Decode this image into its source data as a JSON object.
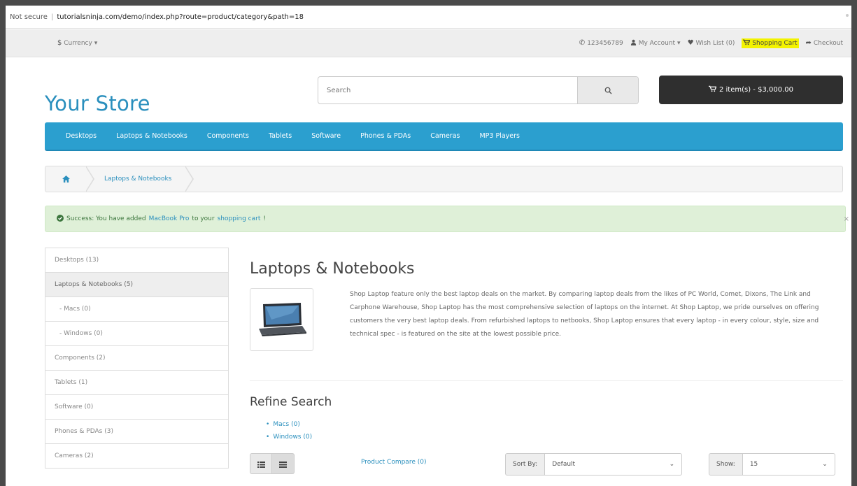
{
  "browser": {
    "security_label": "Not secure",
    "url": "tutorialsninja.com/demo/index.php?route=product/category&path=18"
  },
  "topbar": {
    "currency_symbol": "$",
    "currency_label": "Currency",
    "phone": "123456789",
    "my_account": "My Account",
    "wish_list": "Wish List (0)",
    "shopping_cart": "Shopping Cart",
    "checkout": "Checkout",
    "highlight_color": "#f3f300"
  },
  "header": {
    "logo": "Your Store",
    "search_placeholder": "Search",
    "cart_summary": "2 item(s) - $3,000.00"
  },
  "nav": {
    "items": [
      "Desktops",
      "Laptops & Notebooks",
      "Components",
      "Tablets",
      "Software",
      "Phones & PDAs",
      "Cameras",
      "MP3 Players"
    ],
    "color": "#2b9fcf"
  },
  "breadcrumb": {
    "current": "Laptops & Notebooks"
  },
  "alert": {
    "prefix": "Success: You have added",
    "product": "MacBook Pro",
    "middle": "to your",
    "cart_link": "shopping cart",
    "suffix": "!"
  },
  "sidebar": {
    "items": [
      "Desktops (13)",
      "Laptops & Notebooks (5)",
      "- Macs (0)",
      "- Windows (0)",
      "Components (2)",
      "Tablets (1)",
      "Software (0)",
      "Phones & PDAs (3)",
      "Cameras (2)"
    ]
  },
  "content": {
    "title": "Laptops & Notebooks",
    "description": "Shop Laptop feature only the best laptop deals on the market. By comparing laptop deals from the likes of PC World, Comet, Dixons, The Link and Carphone Warehouse, Shop Laptop has the most comprehensive selection of laptops on the internet. At Shop Laptop, we pride ourselves on offering customers the very best laptop deals. From refurbished laptops to netbooks, Shop Laptop ensures that every laptop - in every colour, style, size and technical spec - is featured on the site at the lowest possible price.",
    "refine_title": "Refine Search",
    "refine_links": [
      "Macs (0)",
      "Windows (0)"
    ],
    "product_compare": "Product Compare (0)",
    "sort_label": "Sort By:",
    "sort_value": "Default",
    "show_label": "Show:",
    "show_value": "15"
  }
}
